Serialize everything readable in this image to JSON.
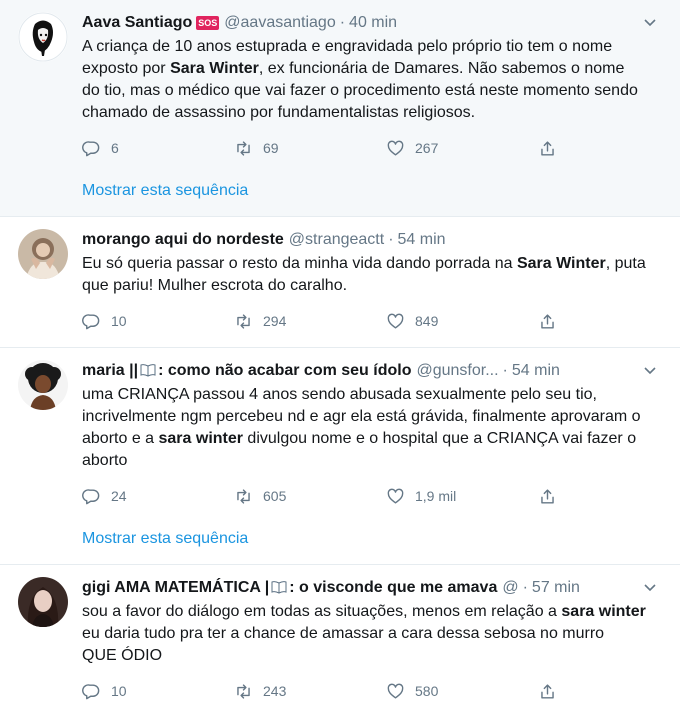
{
  "tweets": [
    {
      "name": "Aava Santiago",
      "badge": "SOS",
      "handle": "@aavasantiago",
      "time": "40 min",
      "text": [
        {
          "t": "A criança de 10 anos estuprada e engravidada pelo próprio tio tem o nome exposto por "
        },
        {
          "b": "Sara Winter"
        },
        {
          "t": ", ex funcionária de Damares. Não sabemos o nome do tio, mas o médico que vai fazer o procedimento está neste momento sendo chamado de assassino por fundamentalistas religiosos."
        }
      ],
      "replies": "6",
      "retweets": "69",
      "likes": "267",
      "show_thread": "Mostrar esta sequência"
    },
    {
      "name": "morango aqui do nordeste",
      "handle": "@strangeactt",
      "time": "54 min",
      "text": [
        {
          "t": "Eu só queria passar o resto da minha vida dando porrada na "
        },
        {
          "b": "Sara Winter"
        },
        {
          "t": ", puta que pariu! Mulher escrota do caralho."
        }
      ],
      "replies": "10",
      "retweets": "294",
      "likes": "849"
    },
    {
      "name_before": "maria ||",
      "name_after": ": como não acabar com seu ídolo",
      "handle": "@gunsfor...",
      "time": "54 min",
      "text": [
        {
          "t": "uma CRIANÇA passou 4 anos sendo abusada sexualmente pelo seu tio, incrivelmente ngm percebeu nd e agr ela está grávida, finalmente aprovaram o aborto e a "
        },
        {
          "b": "sara winter"
        },
        {
          "t": " divulgou nome e o hospital que a CRIANÇA vai fazer o aborto"
        }
      ],
      "replies": "24",
      "retweets": "605",
      "likes": "1,9 mil",
      "show_thread": "Mostrar esta sequência"
    },
    {
      "name_before": "gigi AMA MATEMÁTICA |",
      "name_after": ": o visconde que me amava",
      "handle": "@",
      "time": "57 min",
      "text": [
        {
          "t": "sou a favor do diálogo em todas as situações, menos em relação a "
        },
        {
          "b": "sara winter"
        },
        {
          "br": true
        },
        {
          "t": "eu daria tudo pra ter a chance de amassar a cara dessa sebosa no murro"
        },
        {
          "br": true
        },
        {
          "t": "QUE ÓDIO"
        }
      ],
      "replies": "10",
      "retweets": "243",
      "likes": "580"
    }
  ],
  "colors": {
    "text": "#14171a",
    "muted": "#657786",
    "link": "#1b95e0",
    "highlight_bg": "#f5f8fa",
    "sos_badge": "#e0245e"
  },
  "icons": [
    "reply-icon",
    "retweet-icon",
    "like-icon",
    "share-icon",
    "caret-down-icon",
    "open-book-emoji",
    "sos-emoji"
  ]
}
